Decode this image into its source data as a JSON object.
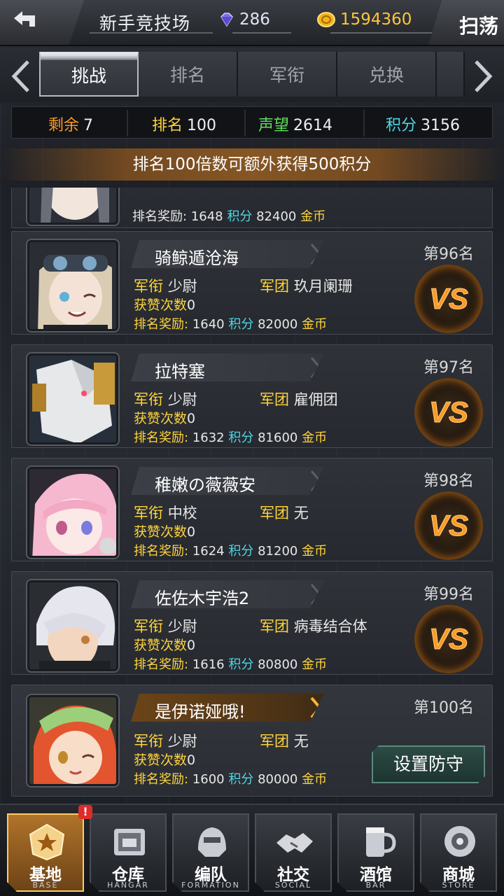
{
  "header": {
    "title": "新手竞技场",
    "diamonds": "286",
    "gold": "1594360",
    "sweep_label": "扫荡"
  },
  "tabs": [
    {
      "label": "挑战",
      "active": true
    },
    {
      "label": "排名",
      "active": false
    },
    {
      "label": "军衔",
      "active": false
    },
    {
      "label": "兑换",
      "active": false
    }
  ],
  "stats": {
    "remaining_label": "剩余",
    "remaining": "7",
    "rank_label": "排名",
    "rank": "100",
    "prestige_label": "声望",
    "prestige": "2614",
    "points_label": "积分",
    "points": "3156"
  },
  "banner": "排名100倍数可额外获得500积分",
  "labels": {
    "military_rank": "军衔",
    "legion": "军团",
    "likes": "获赞次数",
    "reward": "排名奖励:",
    "points_unit": "积分",
    "gold_unit": "金币"
  },
  "partial_top": {
    "reward_points": "1648",
    "reward_gold": "82400"
  },
  "players": [
    {
      "name": "骑鲸遁沧海",
      "rank": "第96名",
      "military_rank": "少尉",
      "legion": "玖月阑珊",
      "likes": "0",
      "reward_points": "1640",
      "reward_gold": "82000"
    },
    {
      "name": "拉特塞",
      "rank": "第97名",
      "military_rank": "少尉",
      "legion": "雇佣团",
      "likes": "0",
      "reward_points": "1632",
      "reward_gold": "81600"
    },
    {
      "name": "稚嫩の薇薇安",
      "rank": "第98名",
      "military_rank": "中校",
      "legion": "无",
      "likes": "0",
      "reward_points": "1624",
      "reward_gold": "81200"
    },
    {
      "name": "佐佐木宇浩2",
      "rank": "第99名",
      "military_rank": "少尉",
      "legion": "病毒结合体",
      "likes": "0",
      "reward_points": "1616",
      "reward_gold": "80800"
    }
  ],
  "self_player": {
    "name": "是伊诺娅哦!",
    "rank": "第100名",
    "military_rank": "少尉",
    "legion": "无",
    "likes": "0",
    "reward_points": "1600",
    "reward_gold": "80000",
    "defense_label": "设置防守"
  },
  "vs_label": "VS",
  "nav": [
    {
      "label": "基地",
      "sub": "BASE",
      "active": true
    },
    {
      "label": "仓库",
      "sub": "HANGAR",
      "active": false
    },
    {
      "label": "编队",
      "sub": "FORMATION",
      "active": false
    },
    {
      "label": "社交",
      "sub": "SOCIAL",
      "active": false
    },
    {
      "label": "酒馆",
      "sub": "BAR",
      "active": false
    },
    {
      "label": "商城",
      "sub": "STORE",
      "active": false
    }
  ],
  "nav_badge": "!",
  "colors": {
    "yellow": "#ffd43b",
    "cyan": "#4fd6e6",
    "green": "#5ee05a",
    "orange_vs": "#ff9a1f",
    "gold": "#ffc53a"
  }
}
